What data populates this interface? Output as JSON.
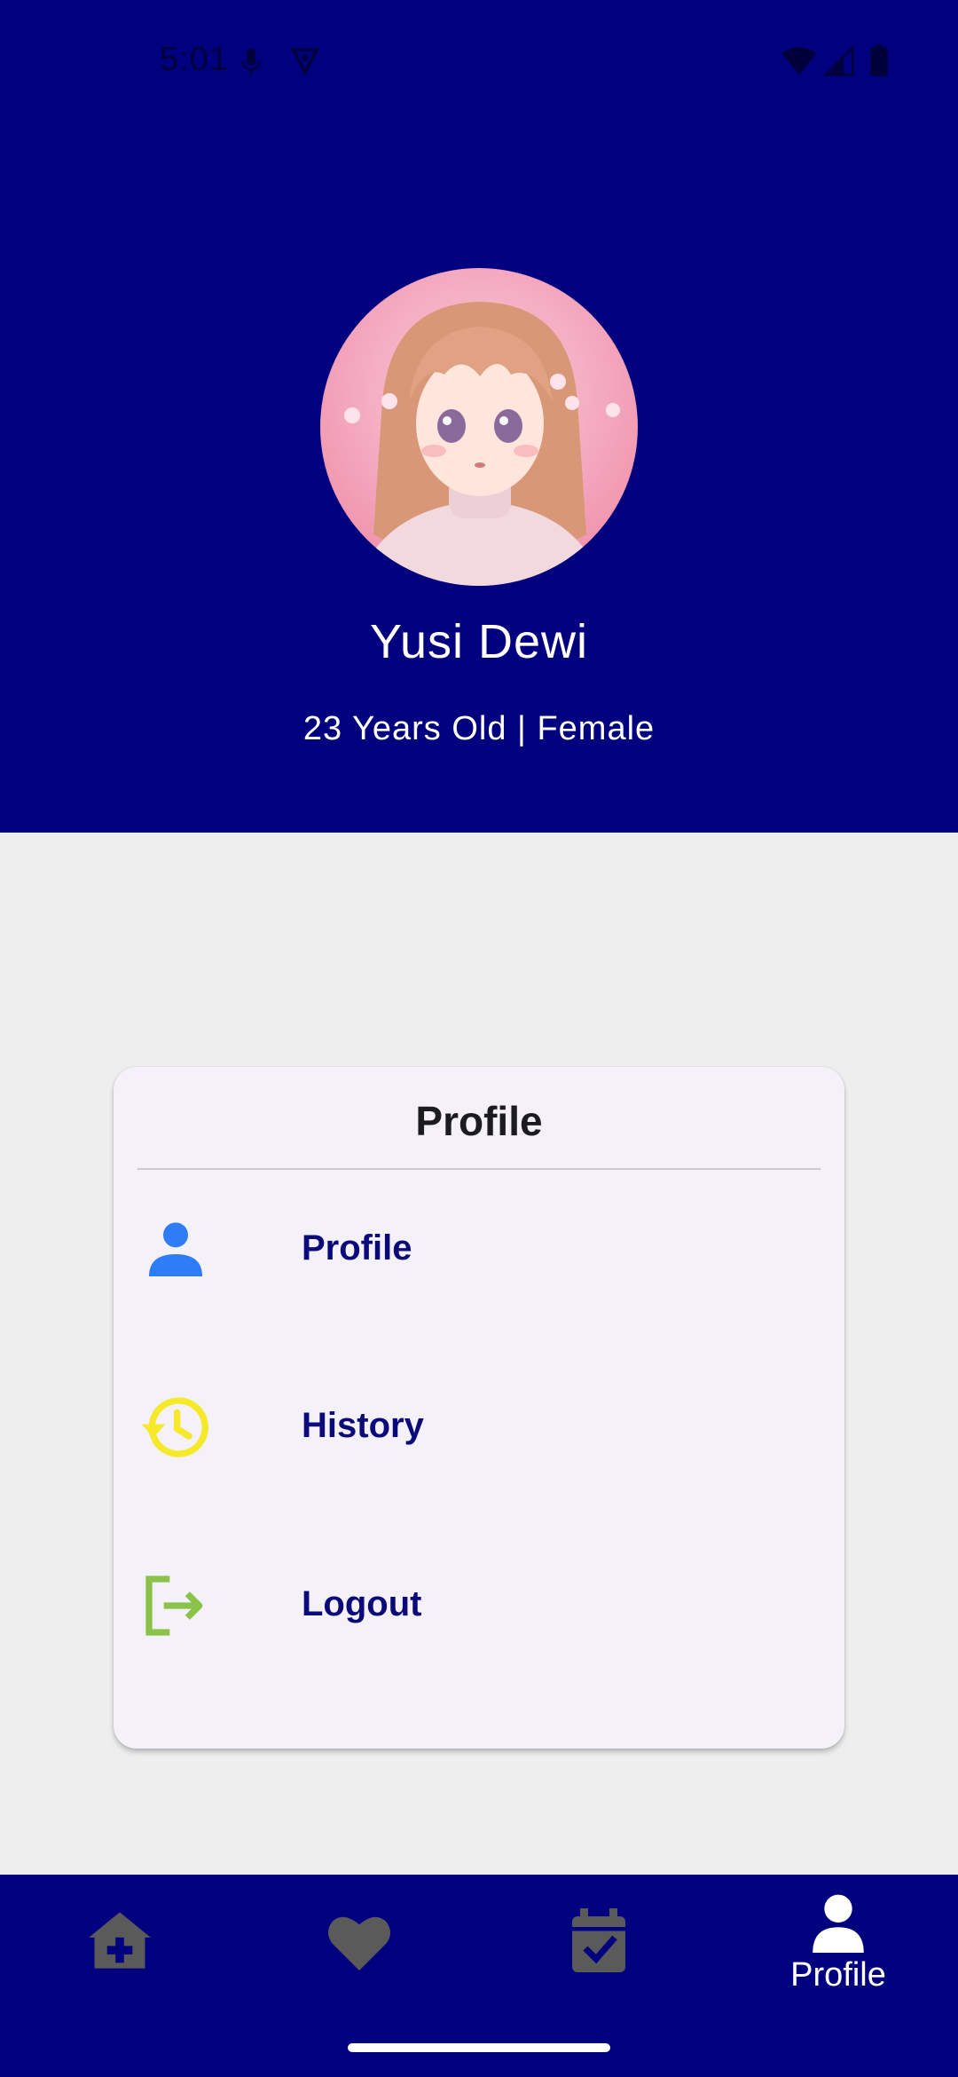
{
  "status_bar": {
    "time": "5:01",
    "icons": [
      "mic-icon",
      "vpn-icon",
      "wifi-icon",
      "signal-icon",
      "battery-icon"
    ]
  },
  "profile": {
    "name": "Yusi Dewi",
    "meta": "23 Years Old | Female",
    "avatar": "avatar-image"
  },
  "card": {
    "title": "Profile",
    "items": [
      {
        "label": "Profile",
        "icon": "person-icon",
        "color": "#2e7cf6"
      },
      {
        "label": "History",
        "icon": "history-icon",
        "color": "#f5e92a"
      },
      {
        "label": "Logout",
        "icon": "logout-icon",
        "color": "#8bc34a"
      }
    ]
  },
  "bottom_nav": {
    "items": [
      {
        "icon": "home-medical-icon",
        "label": ""
      },
      {
        "icon": "heart-icon",
        "label": ""
      },
      {
        "icon": "calendar-check-icon",
        "label": ""
      },
      {
        "icon": "person-icon",
        "label": "Profile",
        "active": true
      }
    ]
  },
  "colors": {
    "header_bg": "#01007f",
    "body_bg": "#eeeeee",
    "card_bg": "#f5f1f9",
    "menu_text": "#0a0a7a",
    "nav_inactive": "#5a5a5a",
    "nav_active": "#ffffff"
  }
}
